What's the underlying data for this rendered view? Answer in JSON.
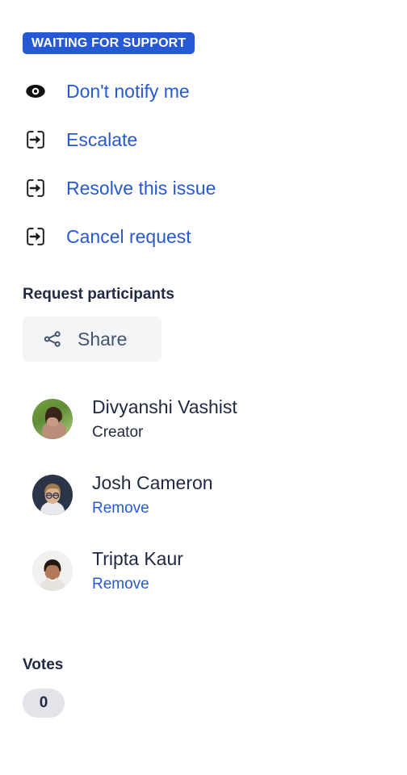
{
  "status": {
    "label": "WAITING FOR SUPPORT",
    "background_color": "#2759d4",
    "text_color": "#ffffff"
  },
  "actions": [
    {
      "label": "Don't notify me",
      "icon": "eye-icon"
    },
    {
      "label": "Escalate",
      "icon": "escalate-icon"
    },
    {
      "label": "Resolve this issue",
      "icon": "escalate-icon"
    },
    {
      "label": "Cancel request",
      "icon": "escalate-icon"
    }
  ],
  "participants_section": {
    "heading": "Request participants",
    "share_button": {
      "label": "Share",
      "icon": "share-icon"
    },
    "people": [
      {
        "name": "Divyanshi Vashist",
        "sub_label": "Creator",
        "sub_is_link": false,
        "avatar": "avatar-divyanshi"
      },
      {
        "name": "Josh Cameron",
        "sub_label": "Remove",
        "sub_is_link": true,
        "avatar": "avatar-josh"
      },
      {
        "name": "Tripta Kaur",
        "sub_label": "Remove",
        "sub_is_link": true,
        "avatar": "avatar-tripta"
      }
    ]
  },
  "votes_section": {
    "heading": "Votes",
    "count": "0"
  },
  "colors": {
    "link": "#2759d4",
    "heading": "#212a41",
    "button_background": "#f4f5f7",
    "pill_background": "#e2e4e9"
  }
}
